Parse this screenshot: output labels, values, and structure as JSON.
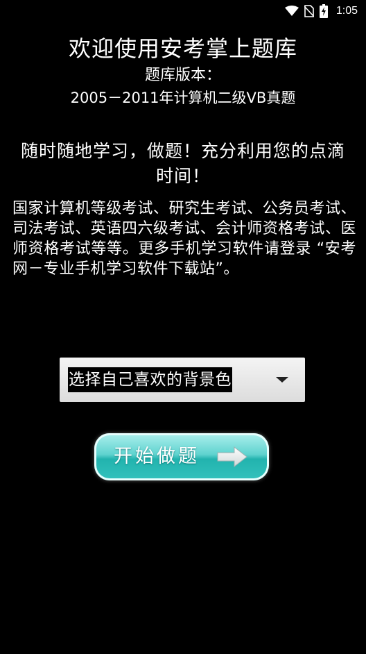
{
  "status_bar": {
    "time": "1:05",
    "icons": [
      "wifi-icon",
      "no-sim-icon",
      "battery-charging-icon"
    ]
  },
  "header": {
    "title": "欢迎使用安考掌上题库",
    "version_label": "题库版本：",
    "version_value": "2005－2011年计算机二级VB真题"
  },
  "slogan": "随时随地学习，做题！充分利用您的点滴时间！",
  "description": "国家计算机等级考试、研究生考试、公务员考试、司法考试、英语四六级考试、会计师资格考试、医师资格考试等等。更多手机学习软件请登录 “安考网－专业手机学习软件下载站”。",
  "background_select": {
    "label": "选择自己喜欢的背景色"
  },
  "start_button": {
    "label": "开始做题",
    "icon": "arrow-right-icon"
  },
  "colors": {
    "background": "#000000",
    "text": "#ffffff",
    "button_teal": "#2fbcb7"
  }
}
